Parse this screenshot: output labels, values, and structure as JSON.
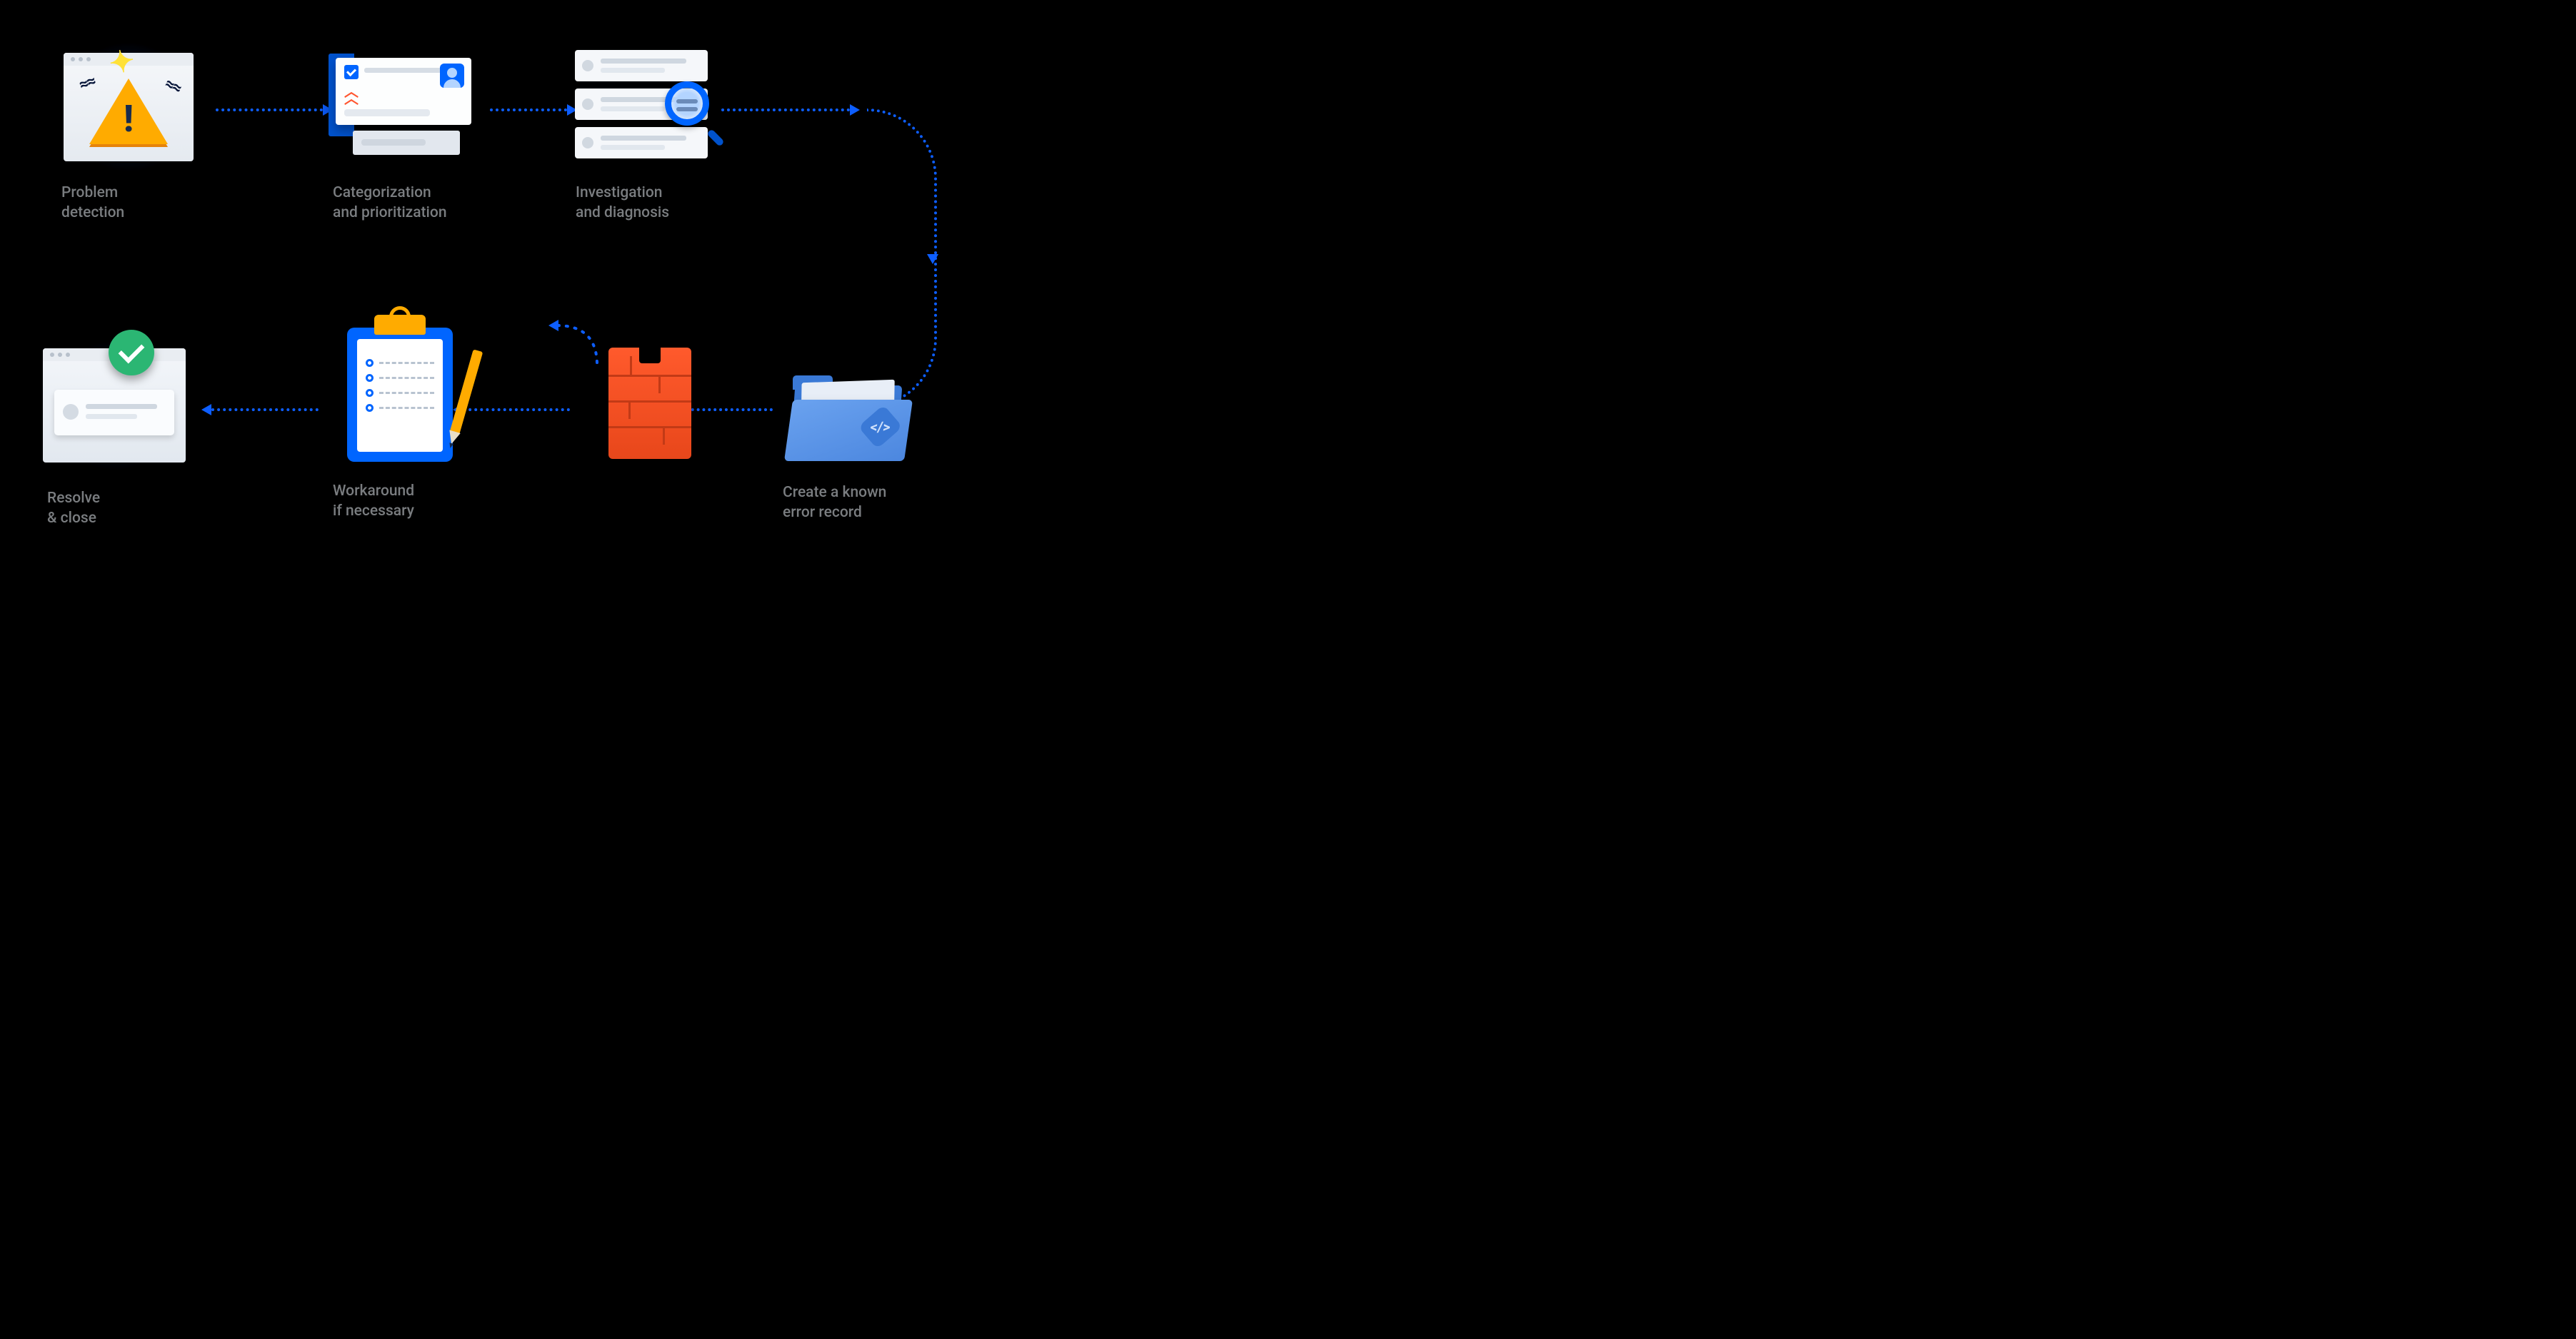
{
  "steps": {
    "detection": {
      "label_l1": "Problem",
      "label_l2": "detection",
      "icon": "warning-window-icon"
    },
    "categorization": {
      "label_l1": "Categorization",
      "label_l2": "and prioritization",
      "icon": "cards-icon"
    },
    "investigation": {
      "label_l1": "Investigation",
      "label_l2": "and diagnosis",
      "icon": "magnifier-list-icon"
    },
    "error_record": {
      "label_l1": "Create a known",
      "label_l2": "error record",
      "icon": "code-folder-icon"
    },
    "wall": {
      "icon": "brick-wall-icon"
    },
    "workaround": {
      "label_l1": "Workaround",
      "label_l2": "if necessary",
      "icon": "clipboard-pencil-icon"
    },
    "resolve": {
      "label_l1": "Resolve",
      "label_l2": "& close",
      "icon": "checkmark-window-icon"
    }
  },
  "flow_order": [
    "detection",
    "categorization",
    "investigation",
    "error_record",
    "wall",
    "workaround",
    "resolve"
  ],
  "colors": {
    "arrow": "#0d5eff",
    "label": "#7a7d80",
    "warning": "#ffab00",
    "success": "#2bb673",
    "brick": "#ff5a2c",
    "primary_blue": "#0065ff"
  }
}
